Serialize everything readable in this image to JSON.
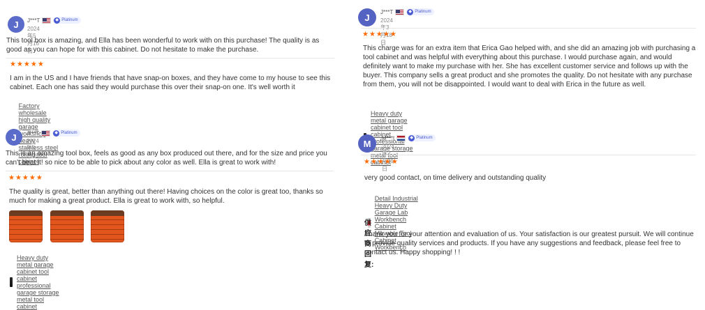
{
  "reviews": [
    {
      "avatar_letter": "J",
      "username": "J***T",
      "badge_label": "Platinum",
      "date": "2024年5月16日",
      "overall_text": "This tool box is amazing, and Ella has been wonderful to work with on this purchase! The quality is as good as you can hope for with this cabinet. Do not hesitate to make the purchase.",
      "rating": "★★★★★",
      "product_text": "I am in the US and I have friends that have snap-on boxes, and they have come to my house to see this cabinet. Each one has said they would purchase this over their snap-on one. It's well worth it",
      "product_link": "Factory wholesale high quality garage workshop heavy stainless steel rolling tool cabinet"
    },
    {
      "avatar_letter": "J",
      "username": "J***T",
      "badge_label": "Platinum",
      "date": "2024年5月16日",
      "overall_text": "This is an amazing tool box, feels as good as any box produced out there, and for the size and price you can't beat it! so nice to be able to pick about any color as well. Ella is great to work with!",
      "rating": "★★★★★",
      "product_text": "The quality is great, better than anything out there! Having choices on the color is great too, thanks so much for making a great product. Ella is great to work with, so helpful.",
      "product_link": "Heavy duty metal garage cabinet tool cabinet professional garage storage metal tool cabinet"
    },
    {
      "avatar_letter": "J",
      "username": "J***T",
      "badge_label": "Platinum",
      "date": "2024年3月18日",
      "rating": "★★★★★",
      "product_text": "This charge was for an extra item that Erica Gao helped with, and she did an amazing job with purchasing a tool cabinet and was helpful with everything about this purchase. I would purchase again, and would definitely want to make my purchase with her. She has excellent customer service and follows up with the buyer. This company sells a great product and she promotes the quality. Do not hesitate with any purchase from them, you will not be disappointed. I would want to deal with Erica in the future as well.",
      "product_link": "Heavy duty metal garage cabinet tool cabinet professional garage storage metal tool cabinet"
    },
    {
      "avatar_letter": "M",
      "username": "M***t",
      "badge_label": "Platinum",
      "date": "2024年2月29日",
      "rating": "★★★★★",
      "product_text": "very good contact, on time delivery and outstanding quality",
      "product_link": "Detail Industrial Heavy Duty Garage Lab Workbench Cabinet Movable Tool Cabinet Workbench",
      "reply_title": "供应商回复:",
      "reply_text": "Thank you for your attention and evaluation of us. Your satisfaction is our greatest pursuit. We will continue to provide quality services and products. If you have any suggestions and feedback, please feel free to contact us. Happy shopping! ! !"
    }
  ],
  "colors": {
    "avatar": "#5b6bc9",
    "star": "#ff6a00",
    "badge_bg": "#eef1ff",
    "badge_text": "#4a5bd1"
  }
}
